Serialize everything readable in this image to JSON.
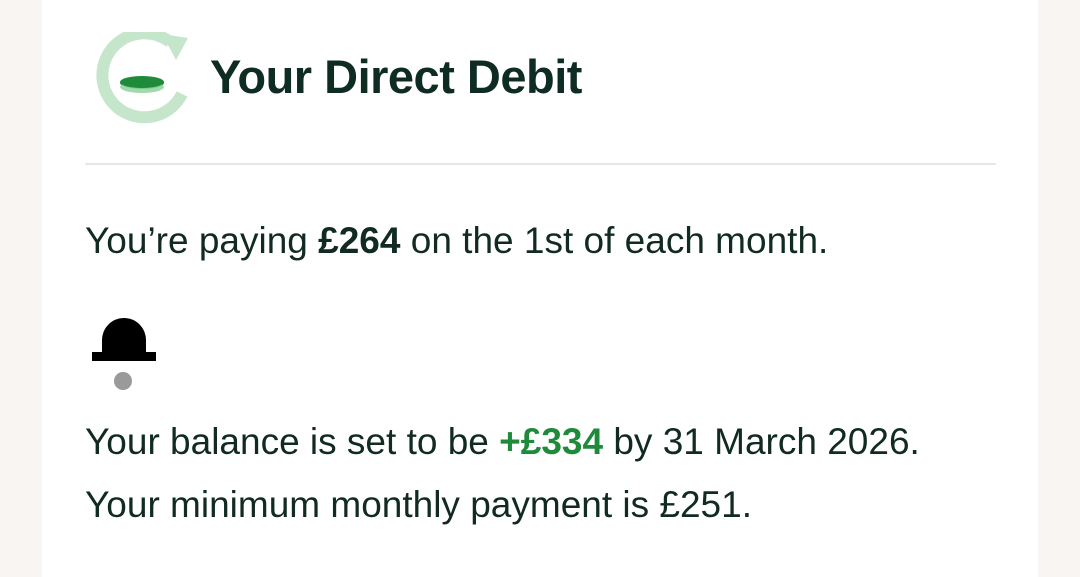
{
  "header": {
    "title": "Your Direct Debit",
    "icon": "direct-debit-refresh-icon"
  },
  "payment": {
    "prefix": "You’re paying ",
    "amount": "£264",
    "suffix": " on the 1st of each month."
  },
  "notice": {
    "icon": "bell-icon",
    "line_prefix": "Your balance is set to be ",
    "balance_amount": "+£334",
    "line_suffix": " by 31 March 2026. Your minimum monthly payment is £251."
  },
  "colors": {
    "title_text": "#0f2c24",
    "body_text": "#112a22",
    "positive_amount": "#1e8a3a",
    "icon_ring": "#c6e6cc",
    "icon_disc": "#1e8a3a",
    "divider": "#e6e6e3",
    "page_background": "#f8f5f2",
    "card_background": "#ffffff"
  }
}
